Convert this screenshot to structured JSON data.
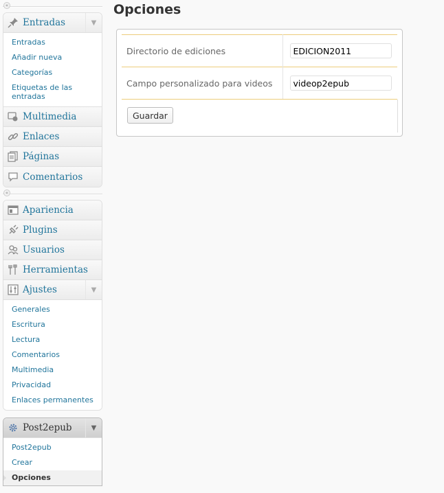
{
  "sidebar": {
    "group1": [
      {
        "label": "Entradas",
        "icon": "pin-icon",
        "open": true,
        "children": [
          "Entradas",
          "Añadir nueva",
          "Categorías",
          "Etiquetas de las entradas"
        ]
      },
      {
        "label": "Multimedia",
        "icon": "media-icon"
      },
      {
        "label": "Enlaces",
        "icon": "link-icon"
      },
      {
        "label": "Páginas",
        "icon": "pages-icon"
      },
      {
        "label": "Comentarios",
        "icon": "comments-icon"
      }
    ],
    "group2": [
      {
        "label": "Apariencia",
        "icon": "appearance-icon"
      },
      {
        "label": "Plugins",
        "icon": "plugins-icon"
      },
      {
        "label": "Usuarios",
        "icon": "users-icon"
      },
      {
        "label": "Herramientas",
        "icon": "tools-icon"
      },
      {
        "label": "Ajustes",
        "icon": "settings-icon",
        "open": true,
        "children": [
          "Generales",
          "Escritura",
          "Lectura",
          "Comentarios",
          "Multimedia",
          "Privacidad",
          "Enlaces permanentes"
        ]
      }
    ],
    "group3": {
      "label": "Post2epub",
      "icon": "gear-icon",
      "children": [
        "Post2epub",
        "Crear",
        "Opciones"
      ],
      "current": "Opciones"
    }
  },
  "main": {
    "title": "Opciones",
    "form": {
      "rows": [
        {
          "label": "Directorio de ediciones",
          "value": "EDICION2011"
        },
        {
          "label": "Campo personalizado para videos",
          "value": "videop2epub"
        }
      ],
      "save_label": "Guardar"
    }
  },
  "colors": {
    "link": "#21759b",
    "table_border": "#eccc7a"
  }
}
